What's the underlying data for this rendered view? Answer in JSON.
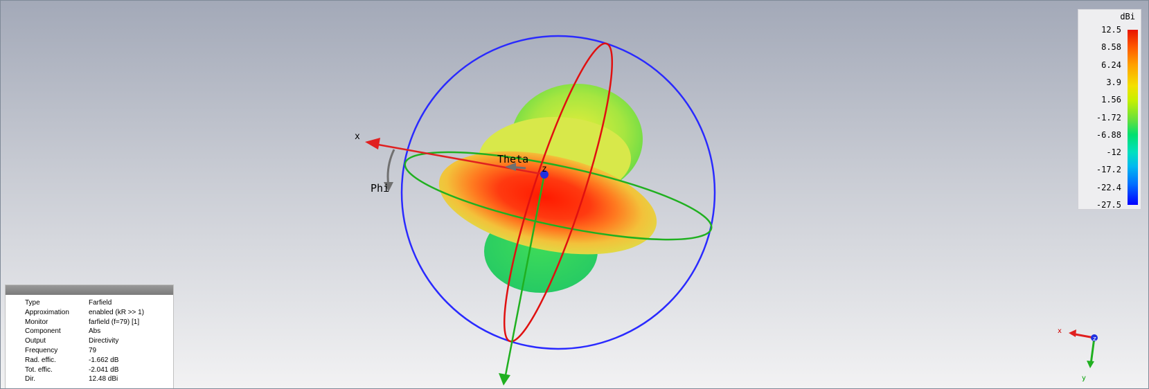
{
  "view": {
    "axis_labels": {
      "x": "x",
      "y": "y",
      "z": "z"
    },
    "angle_labels": {
      "theta": "Theta",
      "phi": "Phi"
    }
  },
  "legend": {
    "unit": "dBi",
    "ticks": [
      "12.5",
      "8.58",
      "6.24",
      "3.9",
      "1.56",
      "-1.72",
      "-6.88",
      "-12",
      "-17.2",
      "-22.4",
      "-27.5"
    ]
  },
  "info": {
    "rows": [
      {
        "key": "Type",
        "value": "Farfield"
      },
      {
        "key": "Approximation",
        "value": "enabled (kR >> 1)"
      },
      {
        "key": "Monitor",
        "value": "farfield (f=79) [1]"
      },
      {
        "key": "Component",
        "value": "Abs"
      },
      {
        "key": "Output",
        "value": "Directivity"
      },
      {
        "key": "Frequency",
        "value": "79"
      },
      {
        "key": "Rad. effic.",
        "value": "-1.662 dB"
      },
      {
        "key": "Tot. effic.",
        "value": "-2.041 dB"
      },
      {
        "key": "Dir.",
        "value": "12.48 dBi"
      }
    ]
  },
  "mini_axes": {
    "x": "x",
    "y": "y",
    "z": "z"
  },
  "colors": {
    "sphere_circle": "#2a2aff",
    "theta_circle": "#e01010",
    "phi_circle": "#20b020",
    "x_axis": "#e02020",
    "y_axis": "#20b020",
    "z_axis": "#2030e0"
  }
}
